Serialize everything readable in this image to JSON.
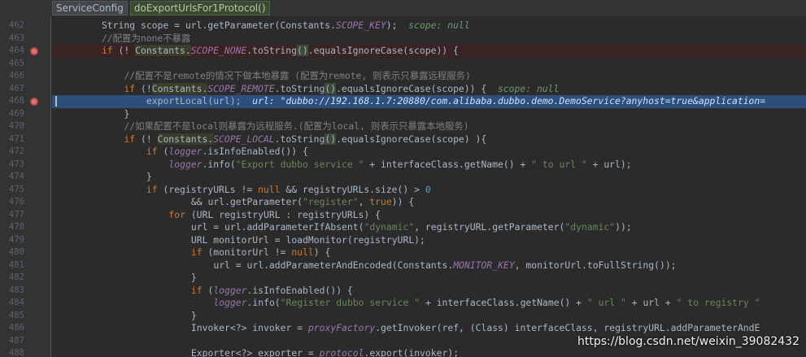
{
  "breadcrumb": {
    "class_name": "ServiceConfig",
    "method_name": "doExportUrlsFor1Protocol()"
  },
  "lines": [
    {
      "num": "462",
      "breakpoint": false,
      "state": "",
      "indent": 8,
      "tokens": [
        {
          "t": "String scope = url.getParameter(Constants."
        },
        {
          "t": "SCOPE_KEY",
          "c": "cn"
        },
        {
          "t": ");  "
        },
        {
          "t": "scope: null",
          "c": "inl"
        }
      ]
    },
    {
      "num": "463",
      "breakpoint": false,
      "state": "",
      "indent": 8,
      "tokens": [
        {
          "t": "//配置为none不暴露",
          "c": "cm"
        }
      ]
    },
    {
      "num": "464",
      "breakpoint": true,
      "state": "bp",
      "indent": 8,
      "tokens": [
        {
          "t": "if",
          "c": "kw"
        },
        {
          "t": " (! "
        },
        {
          "t": "Constants.",
          "c": "hl"
        },
        {
          "t": "SCOPE_NONE",
          "c": "cn"
        },
        {
          "t": ".toString"
        },
        {
          "t": "()",
          "c": "ru"
        },
        {
          "t": ".equalsIgnoreCase(scope)) {"
        }
      ]
    },
    {
      "num": "465",
      "breakpoint": false,
      "state": "",
      "indent": 0,
      "tokens": []
    },
    {
      "num": "466",
      "breakpoint": false,
      "state": "",
      "indent": 12,
      "tokens": [
        {
          "t": "//配置不是remote的情况下做本地暴露 (配置为remote, 则表示只暴露远程服务)",
          "c": "cm"
        }
      ]
    },
    {
      "num": "467",
      "breakpoint": false,
      "state": "",
      "indent": 12,
      "tokens": [
        {
          "t": "if",
          "c": "kw"
        },
        {
          "t": " (!"
        },
        {
          "t": "Constants.",
          "c": "hl"
        },
        {
          "t": "SCOPE_REMOTE",
          "c": "cn"
        },
        {
          "t": ".toString"
        },
        {
          "t": "()",
          "c": "ru"
        },
        {
          "t": ".equalsIgnoreCase(scope)) {  "
        },
        {
          "t": "scope: null",
          "c": "inl"
        }
      ]
    },
    {
      "num": "468",
      "breakpoint": true,
      "state": "exec",
      "indent": 16,
      "tokens": [
        {
          "t": "exportLocal(url);  "
        },
        {
          "t": "url: \"dubbo://192.168.1.7:20880/com.alibaba.dubbo.demo.DemoService?anyhost=true&application=",
          "c": "inl-exec"
        }
      ]
    },
    {
      "num": "469",
      "breakpoint": false,
      "state": "",
      "indent": 12,
      "tokens": [
        {
          "t": "}"
        }
      ]
    },
    {
      "num": "470",
      "breakpoint": false,
      "state": "",
      "indent": 12,
      "tokens": [
        {
          "t": "//如果配置不是local则暴露为远程服务.(配置为local, 则表示只暴露本地服务)",
          "c": "cm"
        }
      ]
    },
    {
      "num": "471",
      "breakpoint": false,
      "state": "",
      "indent": 12,
      "tokens": [
        {
          "t": "if",
          "c": "kw"
        },
        {
          "t": " (! "
        },
        {
          "t": "Constants.",
          "c": "hl"
        },
        {
          "t": "SCOPE_LOCAL",
          "c": "cn"
        },
        {
          "t": ".toString"
        },
        {
          "t": "()",
          "c": "ru"
        },
        {
          "t": ".equalsIgnoreCase(scope) ){"
        }
      ]
    },
    {
      "num": "472",
      "breakpoint": false,
      "state": "",
      "indent": 16,
      "tokens": [
        {
          "t": "if",
          "c": "kw"
        },
        {
          "t": " ("
        },
        {
          "t": "logger",
          "c": "cn"
        },
        {
          "t": ".isInfoEnabled()) {"
        }
      ]
    },
    {
      "num": "473",
      "breakpoint": false,
      "state": "",
      "indent": 20,
      "tokens": [
        {
          "t": "logger",
          "c": "cn"
        },
        {
          "t": ".info("
        },
        {
          "t": "\"Export dubbo service \"",
          "c": "st"
        },
        {
          "t": " + interfaceClass.getName() + "
        },
        {
          "t": "\" to url \"",
          "c": "st"
        },
        {
          "t": " + url);"
        }
      ]
    },
    {
      "num": "474",
      "breakpoint": false,
      "state": "",
      "indent": 16,
      "tokens": [
        {
          "t": "}"
        }
      ]
    },
    {
      "num": "475",
      "breakpoint": false,
      "state": "",
      "indent": 16,
      "tokens": [
        {
          "t": "if",
          "c": "kw"
        },
        {
          "t": " (registryURLs != "
        },
        {
          "t": "null",
          "c": "kw"
        },
        {
          "t": " && registryURLs.size() > "
        },
        {
          "t": "0",
          "c": "num"
        }
      ]
    },
    {
      "num": "476",
      "breakpoint": false,
      "state": "",
      "indent": 24,
      "tokens": [
        {
          "t": "&& url.getParameter("
        },
        {
          "t": "\"register\"",
          "c": "st"
        },
        {
          "t": ", "
        },
        {
          "t": "true",
          "c": "kw"
        },
        {
          "t": ")) {"
        }
      ]
    },
    {
      "num": "477",
      "breakpoint": false,
      "state": "",
      "indent": 20,
      "tokens": [
        {
          "t": "for",
          "c": "kw"
        },
        {
          "t": " (URL registryURL : registryURLs) {"
        }
      ]
    },
    {
      "num": "478",
      "breakpoint": false,
      "state": "",
      "indent": 24,
      "tokens": [
        {
          "t": "url = url.addParameterIfAbsent("
        },
        {
          "t": "\"dynamic\"",
          "c": "st"
        },
        {
          "t": ", registryURL.getParameter("
        },
        {
          "t": "\"dynamic\"",
          "c": "st"
        },
        {
          "t": "));"
        }
      ]
    },
    {
      "num": "479",
      "breakpoint": false,
      "state": "",
      "indent": 24,
      "tokens": [
        {
          "t": "URL monitorUrl = loadMonitor(registryURL);"
        }
      ]
    },
    {
      "num": "480",
      "breakpoint": false,
      "state": "",
      "indent": 24,
      "tokens": [
        {
          "t": "if",
          "c": "kw"
        },
        {
          "t": " (monitorUrl != "
        },
        {
          "t": "null",
          "c": "kw"
        },
        {
          "t": ") {"
        }
      ]
    },
    {
      "num": "481",
      "breakpoint": false,
      "state": "",
      "indent": 28,
      "tokens": [
        {
          "t": "url = url.addParameterAndEncoded(Constants."
        },
        {
          "t": "MONITOR_KEY",
          "c": "cn"
        },
        {
          "t": ", monitorUrl.toFullString());"
        }
      ]
    },
    {
      "num": "482",
      "breakpoint": false,
      "state": "",
      "indent": 24,
      "tokens": [
        {
          "t": "}"
        }
      ]
    },
    {
      "num": "483",
      "breakpoint": false,
      "state": "",
      "indent": 24,
      "tokens": [
        {
          "t": "if",
          "c": "kw"
        },
        {
          "t": " ("
        },
        {
          "t": "logger",
          "c": "cn"
        },
        {
          "t": ".isInfoEnabled()) {"
        }
      ]
    },
    {
      "num": "484",
      "breakpoint": false,
      "state": "",
      "indent": 28,
      "tokens": [
        {
          "t": "logger",
          "c": "cn"
        },
        {
          "t": ".info("
        },
        {
          "t": "\"Register dubbo service \"",
          "c": "st"
        },
        {
          "t": " + interfaceClass.getName() + "
        },
        {
          "t": "\" url \"",
          "c": "st"
        },
        {
          "t": " + url + "
        },
        {
          "t": "\" to registry \"",
          "c": "st"
        }
      ]
    },
    {
      "num": "485",
      "breakpoint": false,
      "state": "",
      "indent": 24,
      "tokens": [
        {
          "t": "}"
        }
      ]
    },
    {
      "num": "486",
      "breakpoint": false,
      "state": "",
      "indent": 24,
      "tokens": [
        {
          "t": "Invoker<?> invoker = "
        },
        {
          "t": "proxyFactory",
          "c": "cn"
        },
        {
          "t": ".getInvoker(ref, (Class) interfaceClass, registryURL.addParameterAndE"
        }
      ]
    },
    {
      "num": "487",
      "breakpoint": false,
      "state": "",
      "indent": 0,
      "tokens": []
    },
    {
      "num": "488",
      "breakpoint": false,
      "state": "",
      "indent": 24,
      "tokens": [
        {
          "t": "Exporter<?> exporter = "
        },
        {
          "t": "protocol",
          "c": "cn"
        },
        {
          "t": ".export(invoker);"
        }
      ]
    }
  ],
  "watermark": "https://blog.csdn.net/weixin_39082432"
}
